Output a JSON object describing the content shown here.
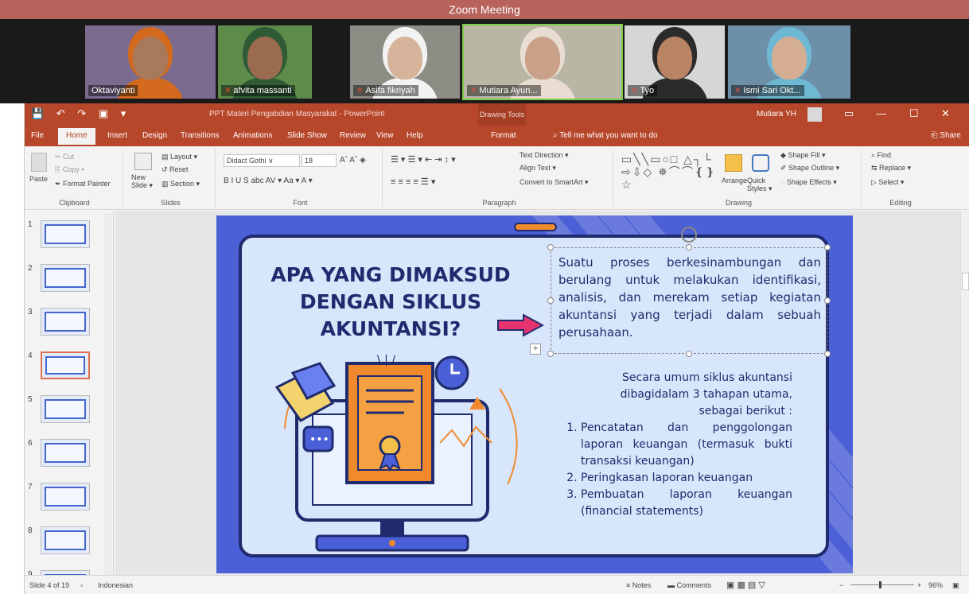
{
  "zoom": {
    "title": "Zoom Meeting",
    "participants": [
      {
        "name": "Oktaviyanti",
        "muted": false,
        "active": false,
        "bg": "#7b6b8f",
        "skin": "#a8795a",
        "hijab": "#d36a1e"
      },
      {
        "name": "afvita massanti",
        "muted": true,
        "active": false,
        "bg": "#5d8c4a",
        "skin": "#9a6b4f",
        "hijab": "#2e5b36"
      },
      {
        "name": "Asifa fikriyah",
        "muted": true,
        "active": false,
        "bg": "#8d8d85",
        "skin": "#d6b49c",
        "hijab": "#f2f2f2"
      },
      {
        "name": "Mutiara Ayun...",
        "muted": true,
        "active": true,
        "bg": "#b9b6a6",
        "skin": "#c9a188",
        "hijab": "#e8ddd0"
      },
      {
        "name": "Tyo",
        "muted": true,
        "active": false,
        "bg": "#d6d6d6",
        "skin": "#b88463",
        "hijab": "#2b2b2b"
      },
      {
        "name": "Ismi Sari Okt...",
        "muted": true,
        "active": false,
        "bg": "#6d8fa8",
        "skin": "#d4ad92",
        "hijab": "#6fb8d4"
      }
    ]
  },
  "ppt": {
    "qat": "💾 ↶ ↷ ▣ ▾",
    "doc_title": "PPT Materi Pengabdian Masyarakat - PowerPoint",
    "context_tab": "Drawing Tools",
    "user": "Mutiara YH",
    "window_controls": [
      "▭",
      "—",
      "☐",
      "✕"
    ],
    "tabs": [
      "File",
      "Home",
      "Insert",
      "Design",
      "Transitions",
      "Animations",
      "Slide Show",
      "Review",
      "View",
      "Help",
      "Format"
    ],
    "tell_me": "⌕  Tell me what you want to do",
    "share": "⎗ Share",
    "ribbon": {
      "paste": "Paste",
      "cut": "✂ Cut",
      "copy": "⎘ Copy ▾",
      "format_painter": "✒ Format Painter",
      "clipboard": "Clipboard",
      "new_slide": "New Slide ▾",
      "layout": "▤ Layout ▾",
      "reset": "↺ Reset",
      "section": "▥ Section ▾",
      "slides": "Slides",
      "font_name": "Didact Gothi ∨",
      "font_size": "18",
      "font_row2": "B  I  U  S  abc  AV ▾  Aa ▾  A ▾",
      "font": "Font",
      "para_row1": "☰ ▾  ☰ ▾  ⇤ ⇥  ↕ ▾",
      "para_row2": "≡  ≡  ≡  ≡  ☰ ▾",
      "text_direction": "Text Direction ▾",
      "align_text": "Align Text ▾",
      "smartart": "Convert to SmartArt ▾",
      "paragraph": "Paragraph",
      "shapes": "▭╲╲▭○□ △┐└⇨⇩◇ ✵⌒⌒❴❵☆",
      "arrange": "Arrange",
      "quick_styles": "Quick Styles ▾",
      "shape_fill": "◆ Shape Fill ▾",
      "shape_outline": "✐ Shape Outline ▾",
      "shape_effects": "◌ Shape Effects ▾",
      "drawing": "Drawing",
      "find": "⌕ Find",
      "replace": "⇆ Replace ▾",
      "select": "▷ Select ▾",
      "editing": "Editing"
    },
    "thumbnails": [
      "1",
      "2",
      "3",
      "4",
      "5",
      "6",
      "7",
      "8",
      "9"
    ],
    "selected_thumb": 4,
    "slide": {
      "title": "APA YANG DIMAKSUD DENGAN SIKLUS AKUNTANSI?",
      "definition": "Suatu proses berkesinambungan dan berulang untuk melakukan identifikasi, analisis, dan merekam setiap kegiatan akuntansi yang terjadi dalam sebuah perusahaan.",
      "intro": "Secara umum siklus akuntansi dibagidalam 3 tahapan utama, sebagai berikut :",
      "steps": [
        "Pencatatan dan penggolongan laporan keuangan (termasuk bukti transaksi keuangan)",
        "Peringkasan laporan keuangan",
        "Pembuatan laporan keuangan (financial statements)"
      ],
      "rays": "\\ | /"
    },
    "status": {
      "slide_info": "Slide 4 of 19",
      "language": "Indonesian",
      "notes": "≡ Notes",
      "comments": "▬ Comments",
      "view_icons": "▣  ▦  ▤  ▽",
      "zoom": "96%",
      "minus": "−",
      "plus": "+"
    }
  }
}
